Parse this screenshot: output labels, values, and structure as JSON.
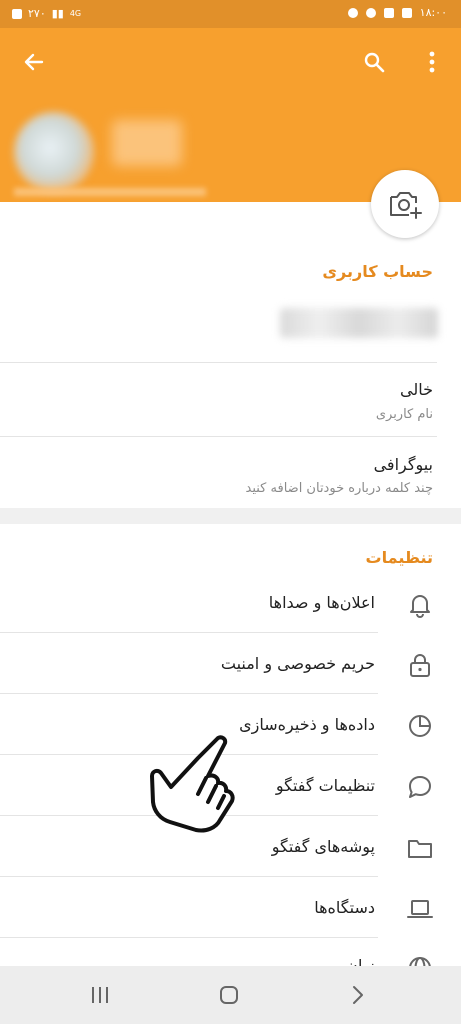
{
  "status_bar": {
    "left_text": "۲۷۰",
    "network": "4G",
    "time": "۱۸:۰۰"
  },
  "header": {
    "back_icon": "arrow-left-icon",
    "search_icon": "search-icon",
    "menu_icon": "more-vertical-icon",
    "camera_icon": "add-photo-icon"
  },
  "account": {
    "section_title": "حساب کاربری",
    "username_value": "خالی",
    "username_label": "نام کاربری",
    "bio_title": "بیوگرافی",
    "bio_hint": "چند کلمه درباره خودتان اضافه کنید"
  },
  "settings": {
    "section_title": "تنظیمات",
    "items": [
      {
        "label": "اعلان‌ها و صداها",
        "icon": "bell-icon"
      },
      {
        "label": "حریم خصوصی و امنیت",
        "icon": "lock-icon"
      },
      {
        "label": "داده‌ها و ذخیره‌سازی",
        "icon": "pie-chart-icon"
      },
      {
        "label": "تنظیمات گفتگو",
        "icon": "chat-bubble-icon"
      },
      {
        "label": "پوشه‌های گفتگو",
        "icon": "folder-icon"
      },
      {
        "label": "دستگاه‌ها",
        "icon": "laptop-icon"
      },
      {
        "label": "زبان",
        "icon": "globe-icon"
      }
    ]
  },
  "nav_bar": {
    "recents_icon": "recents-icon",
    "home_icon": "home-icon",
    "back_icon": "chevron-right-icon"
  },
  "colors": {
    "header": "#f7a02e",
    "status_bar": "#e1902a",
    "accent": "#e58a1f"
  }
}
